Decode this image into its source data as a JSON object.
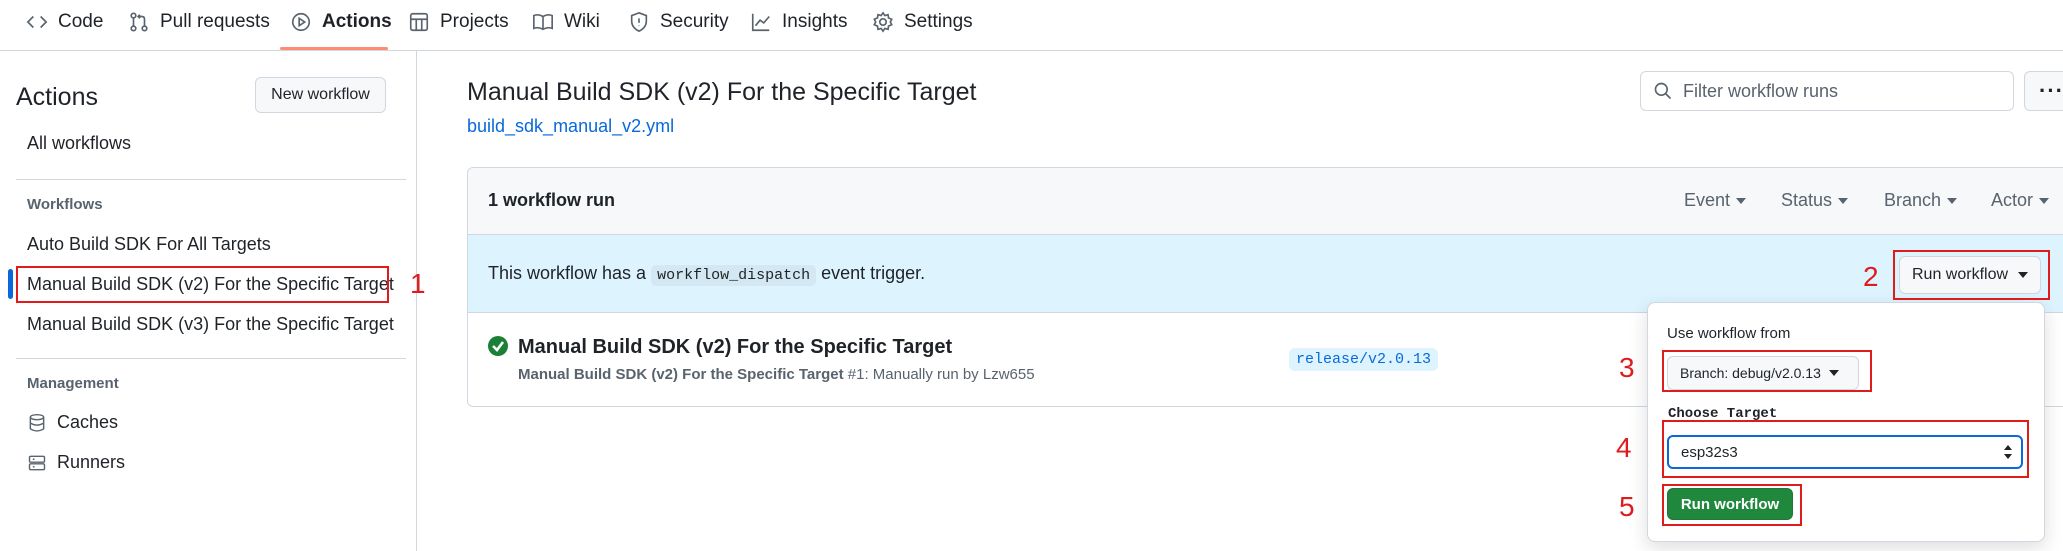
{
  "nav": {
    "tabs": [
      {
        "label": "Code",
        "icon": "code-icon"
      },
      {
        "label": "Pull requests",
        "icon": "pull-request-icon"
      },
      {
        "label": "Actions",
        "icon": "actions-icon"
      },
      {
        "label": "Projects",
        "icon": "projects-icon"
      },
      {
        "label": "Wiki",
        "icon": "book-icon"
      },
      {
        "label": "Security",
        "icon": "shield-icon"
      },
      {
        "label": "Insights",
        "icon": "graph-icon"
      },
      {
        "label": "Settings",
        "icon": "gear-icon"
      }
    ],
    "active_tab": "Actions"
  },
  "sidebar": {
    "title": "Actions",
    "new_workflow": "New workflow",
    "all_workflows": "All workflows",
    "workflows_heading": "Workflows",
    "workflows": [
      "Auto Build SDK For All Targets",
      "Manual Build SDK (v2) For the Specific Target",
      "Manual Build SDK (v3) For the Specific Target"
    ],
    "management_heading": "Management",
    "management": [
      {
        "label": "Caches",
        "icon": "database-icon"
      },
      {
        "label": "Runners",
        "icon": "server-icon"
      }
    ]
  },
  "main": {
    "title": "Manual Build SDK (v2) For the Specific Target",
    "file": "build_sdk_manual_v2.yml",
    "filter_placeholder": "Filter workflow runs",
    "more": "···",
    "count": "1 workflow run",
    "filters": [
      "Event",
      "Status",
      "Branch",
      "Actor"
    ],
    "dispatch_prefix": "This workflow has a",
    "dispatch_code": "workflow_dispatch",
    "dispatch_suffix": "event trigger.",
    "run_workflow": "Run workflow",
    "run": {
      "title": "Manual Build SDK (v2) For the Specific Target",
      "sub_bold": "Manual Build SDK (v2) For the Specific Target",
      "sub_rest": "#1: Manually run by Lzw655",
      "branch": "release/v2.0.13",
      "status_icon": "check-circle-icon"
    }
  },
  "popover": {
    "use_from": "Use workflow from",
    "branch_label": "Branch: debug/v2.0.13",
    "choose_target": "Choose Target",
    "target_value": "esp32s3",
    "submit": "Run workflow"
  },
  "annotations": {
    "labels": [
      "1",
      "2",
      "3",
      "4",
      "5"
    ],
    "color": "#e01b1b"
  },
  "colors": {
    "accent": "#0969da",
    "success": "#1f883d",
    "dispatch_bg": "#ddf4ff",
    "tab_underline": "#fd8c73"
  }
}
